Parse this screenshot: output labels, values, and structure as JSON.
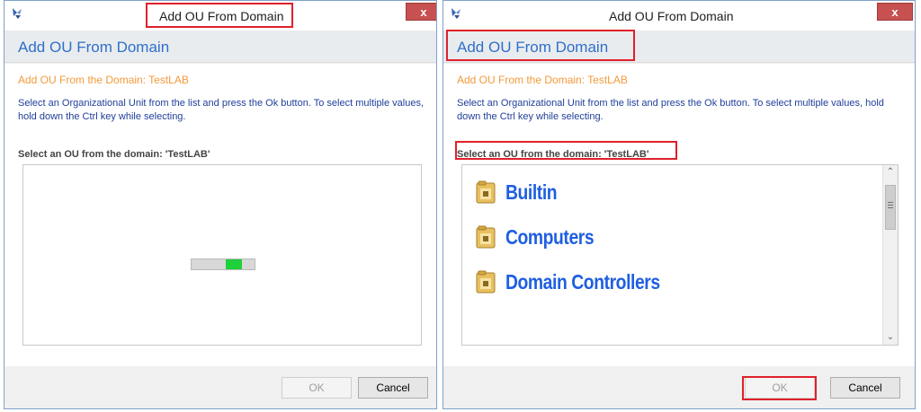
{
  "colors": {
    "header_title": "#2f6fca",
    "subtitle": "#f39a3b",
    "instructions": "#1f3f9a",
    "highlight": "#e0202a",
    "progress_fill": "#1fd03a",
    "ou_name": "#1f5fe0",
    "close_button": "#c75050"
  },
  "left_window": {
    "title": "Add OU From Domain",
    "header": "Add OU From Domain",
    "subtitle": "Add OU From the Domain: TestLAB",
    "instructions": "Select an Organizational Unit from the list and press the Ok button.  To select multiple values, hold down the Ctrl key while selecting.",
    "section_label": "Select an OU from the domain: 'TestLAB'",
    "ok_label": "OK",
    "cancel_label": "Cancel",
    "close_label": "x"
  },
  "right_window": {
    "title": "Add OU From Domain",
    "header": "Add OU From Domain",
    "subtitle": "Add OU From the Domain: TestLAB",
    "instructions": "Select an Organizational Unit from the list and press the Ok button.  To select multiple values, hold down the Ctrl key while selecting.",
    "section_label": "Select an OU from the domain: 'TestLAB'",
    "ou_items": [
      {
        "name": "Builtin",
        "icon": "ou-folder-icon"
      },
      {
        "name": "Computers",
        "icon": "ou-folder-icon"
      },
      {
        "name": "Domain Controllers",
        "icon": "ou-folder-icon"
      }
    ],
    "ok_label": "OK",
    "cancel_label": "Cancel",
    "close_label": "x"
  }
}
